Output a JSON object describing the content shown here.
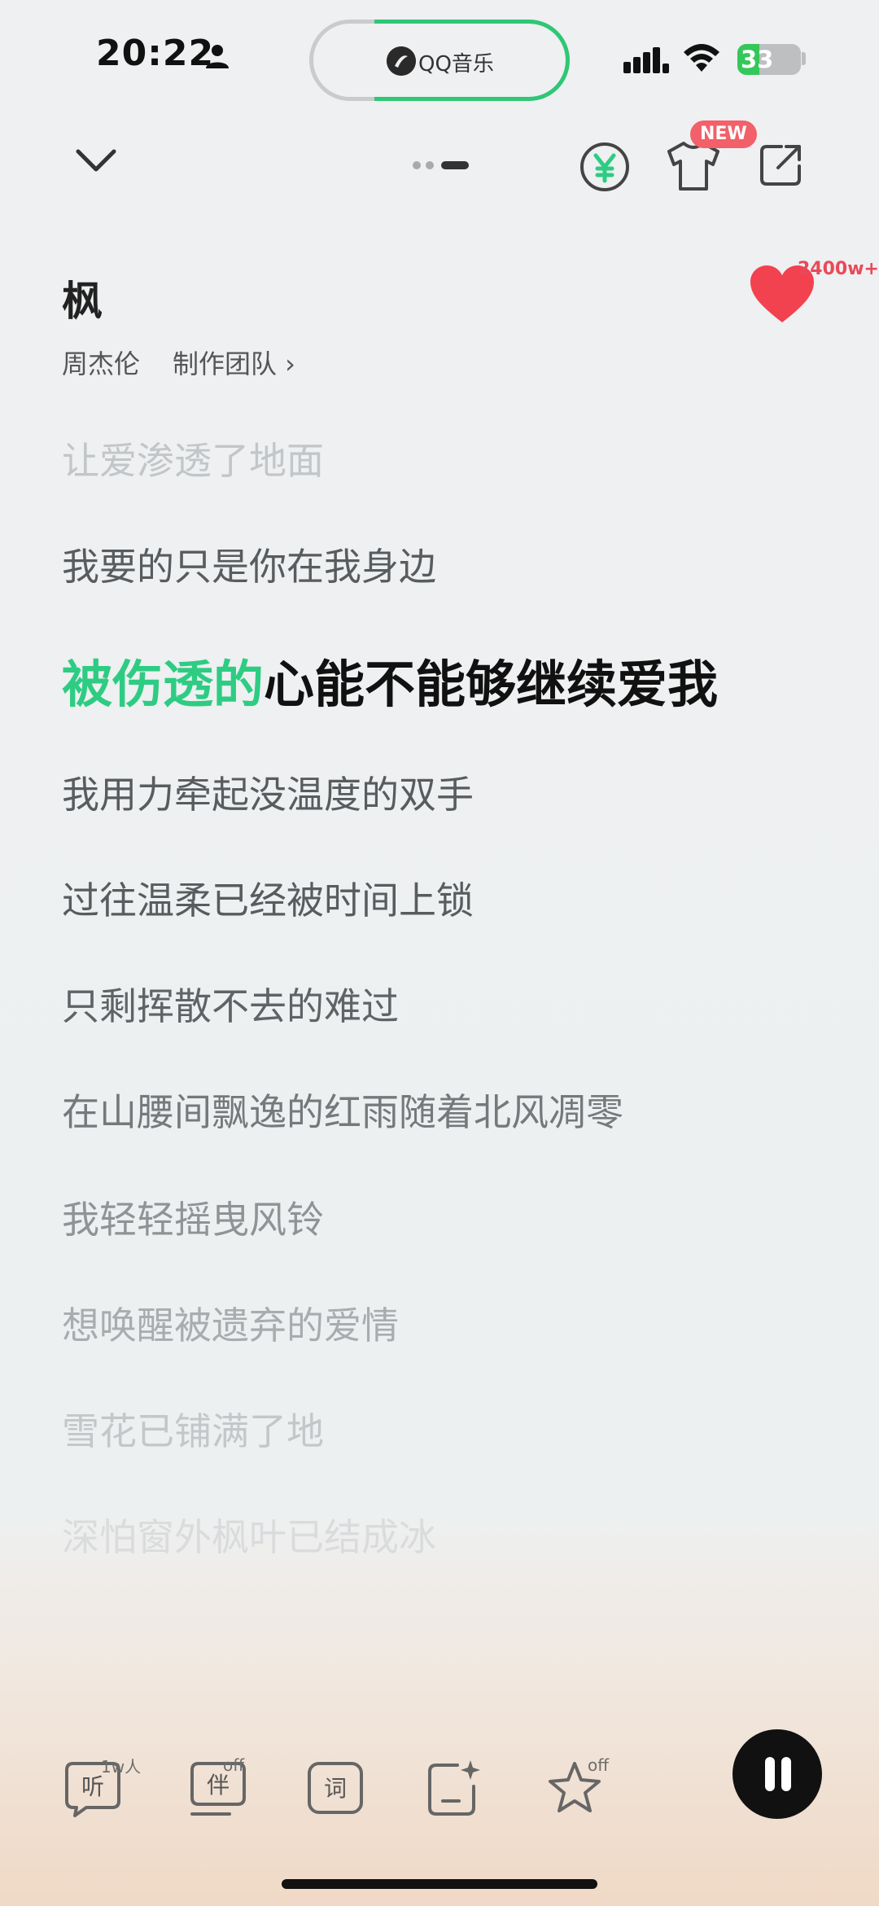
{
  "status_bar": {
    "time": "20:22",
    "battery_level": "33",
    "now_playing_app": "QQ音乐"
  },
  "toolbar": {
    "new_badge": "NEW"
  },
  "song": {
    "title": "枫",
    "artist": "周杰伦",
    "credits_label": "制作团队 ›",
    "like_count": "2400w+"
  },
  "lyrics": {
    "lines_before": [
      "让爱渗透了地面",
      "我要的只是你在我身边"
    ],
    "current_sung": "被伤透的",
    "current_unsung": "心能不能够继续爱我",
    "lines_after": [
      "我用力牵起没温度的双手",
      "过往温柔已经被时间上锁",
      "只剩挥散不去的难过",
      "在山腰间飘逸的红雨随着北风凋零",
      "我轻轻摇曳风铃",
      "想唤醒被遗弃的爱情",
      "雪花已铺满了地",
      "深怕窗外枫叶已结成冰"
    ]
  },
  "bottom_bar": {
    "listen_label": "听",
    "listen_badge": "1w人",
    "accompany_label": "伴",
    "accompany_badge": "off",
    "lyrics_label": "词",
    "favorite_badge": "off"
  },
  "colors": {
    "accent": "#2ecc83",
    "heart": "#f2424f",
    "badge": "#f2606a"
  },
  "icons": {
    "person": "person-icon",
    "signal": "cellular-signal-icon",
    "wifi": "wifi-icon",
    "collapse": "chevron-down-icon",
    "vip": "yen-coin-icon",
    "skin": "tshirt-icon",
    "share": "share-icon",
    "heart": "heart-icon",
    "pause": "pause-icon"
  }
}
